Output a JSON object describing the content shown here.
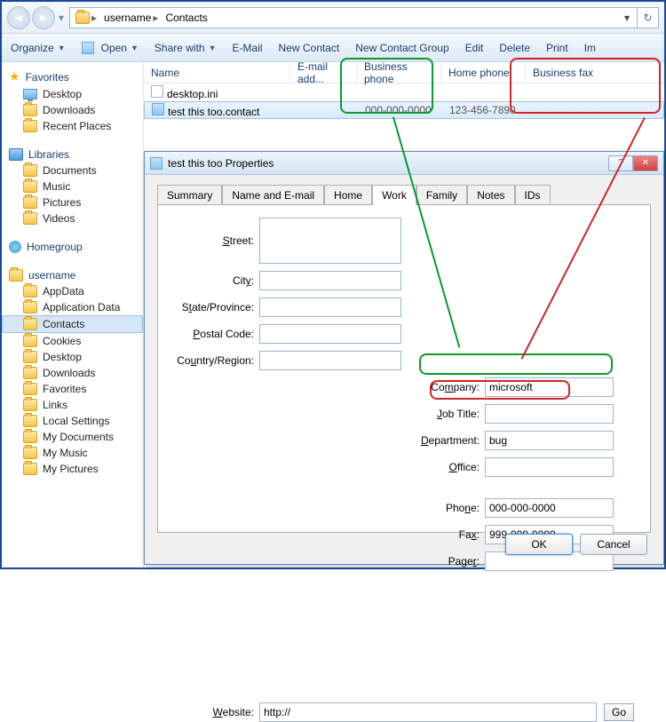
{
  "breadcrumb": {
    "seg1": "username",
    "seg2": "Contacts"
  },
  "toolbar": {
    "organize": "Organize",
    "open": "Open",
    "share": "Share with",
    "email": "E-Mail",
    "newcontact": "New Contact",
    "newgroup": "New Contact Group",
    "edit": "Edit",
    "delete": "Delete",
    "print": "Print",
    "import": "Im"
  },
  "tree": {
    "favorites": "Favorites",
    "fav_items": {
      "desktop": "Desktop",
      "downloads": "Downloads",
      "recent": "Recent Places"
    },
    "libraries": "Libraries",
    "lib_items": {
      "documents": "Documents",
      "music": "Music",
      "pictures": "Pictures",
      "videos": "Videos"
    },
    "homegroup": "Homegroup",
    "userfolder": "username",
    "user_items": {
      "appdata": "AppData",
      "applicationdata": "Application Data",
      "contacts": "Contacts",
      "cookies": "Cookies",
      "desktop": "Desktop",
      "downloads": "Downloads",
      "favorites": "Favorites",
      "links": "Links",
      "localsettings": "Local Settings",
      "mydocuments": "My Documents",
      "mymusic": "My Music",
      "mypictures": "My Pictures"
    }
  },
  "columns": {
    "name": "Name",
    "email": "E-mail add...",
    "bp": "Business phone",
    "hp": "Home phone",
    "bf": "Business fax"
  },
  "files": {
    "r0": {
      "name": "desktop.ini"
    },
    "r1": {
      "name": "test this too.contact",
      "bp": "000-000-0000",
      "hp": "123-456-7890"
    }
  },
  "dialog": {
    "title": "test this too Properties",
    "tabs": {
      "summary": "Summary",
      "name": "Name and E-mail",
      "home": "Home",
      "work": "Work",
      "family": "Family",
      "notes": "Notes",
      "ids": "IDs"
    },
    "labels": {
      "street": "Street:",
      "city": "City:",
      "state": "State/Province:",
      "postal": "Postal Code:",
      "country": "Country/Region:",
      "company": "Company:",
      "jobtitle": "Job Title:",
      "department": "Department:",
      "office": "Office:",
      "phone": "Phone:",
      "fax": "Fax:",
      "pager": "Pager:",
      "website": "Website:"
    },
    "u": {
      "street": "S",
      "city": "y",
      "state": "t",
      "postal": "P",
      "country": "u",
      "company": "m",
      "jobtitle": "J",
      "department": "D",
      "office": "O",
      "phone": "n",
      "fax": "x",
      "pager": "r",
      "website": "W"
    },
    "values": {
      "company": "microsoft",
      "department": "bug",
      "phone": "000-000-0000",
      "fax": "999-999-9999",
      "website": "http://"
    },
    "buttons": {
      "go": "Go",
      "ok": "OK",
      "cancel": "Cancel",
      "help": "?",
      "close": "✕"
    }
  }
}
